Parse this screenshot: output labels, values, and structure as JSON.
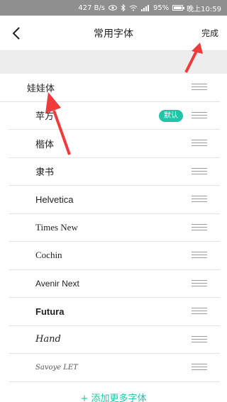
{
  "status_bar": {
    "speed": "427 B/s",
    "battery": "95%",
    "time": "晚上10:59"
  },
  "nav": {
    "title": "常用字体",
    "done": "完成"
  },
  "fonts": [
    {
      "name": "娃娃体",
      "is_default": false
    },
    {
      "name": "苹方",
      "is_default": true
    },
    {
      "name": "楷体",
      "is_default": false
    },
    {
      "name": "隶书",
      "is_default": false
    },
    {
      "name": "Helvetica",
      "is_default": false
    },
    {
      "name": "Times New",
      "is_default": false
    },
    {
      "name": "Cochin",
      "is_default": false
    },
    {
      "name": "Avenir Next",
      "is_default": false
    },
    {
      "name": "Futura",
      "is_default": false
    },
    {
      "name": "Hand",
      "is_default": false
    },
    {
      "name": "Savoye LET",
      "is_default": false
    }
  ],
  "default_badge": "默认",
  "add_more": "+ 添加更多字体",
  "colors": {
    "accent": "#1ec5a6",
    "arrow": "#ee3b3b",
    "status_bar": "#8f8f8f"
  }
}
